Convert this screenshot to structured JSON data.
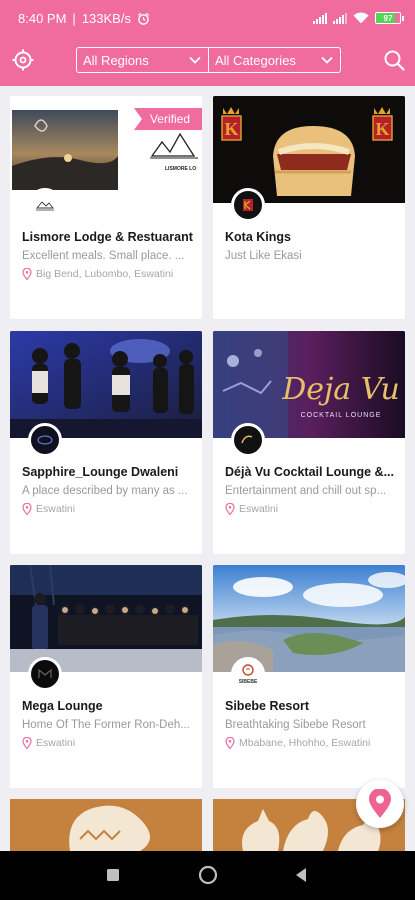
{
  "status": {
    "time": "8:40 PM",
    "speed": "133KB/s",
    "battery": "97"
  },
  "filters": {
    "region": "All Regions",
    "category": "All Categories"
  },
  "verified_label": "Verified",
  "listings": [
    {
      "name": "Lismore Lodge & Restuarant",
      "description": "Excellent meals. Small place. ...",
      "location": "Big Bend, Lubombo, Eswatini",
      "verified": true
    },
    {
      "name": "Kota Kings",
      "description": "Just Like Ekasi",
      "location": "",
      "verified": false
    },
    {
      "name": "Sapphire_Lounge Dwaleni",
      "description": "A place described by many as ...",
      "location": "Eswatini",
      "verified": false
    },
    {
      "name": "Déjà Vu Cocktail Lounge &...",
      "description": "Entertainment and chill out sp...",
      "location": "Eswatini",
      "verified": false
    },
    {
      "name": "Mega Lounge",
      "description": "Home Of The Former Ron-Deh...",
      "location": "Eswatini",
      "verified": false
    },
    {
      "name": "Sibebe Resort",
      "description": "Breathtaking Sibebe Resort",
      "location": "Mbabane, Hhohho, Eswatini",
      "verified": false
    }
  ],
  "image_text": {
    "lismore_logo": "LISMORE LO",
    "kota_letter": "K",
    "dejavu_script": "Deja Vu",
    "dejavu_sub": "COCKTAIL LOUNGE",
    "sibebe_logo": "SIBEBE"
  },
  "colors": {
    "brand_pink": "#f06b9e",
    "fab_pin": "#ee6390"
  }
}
